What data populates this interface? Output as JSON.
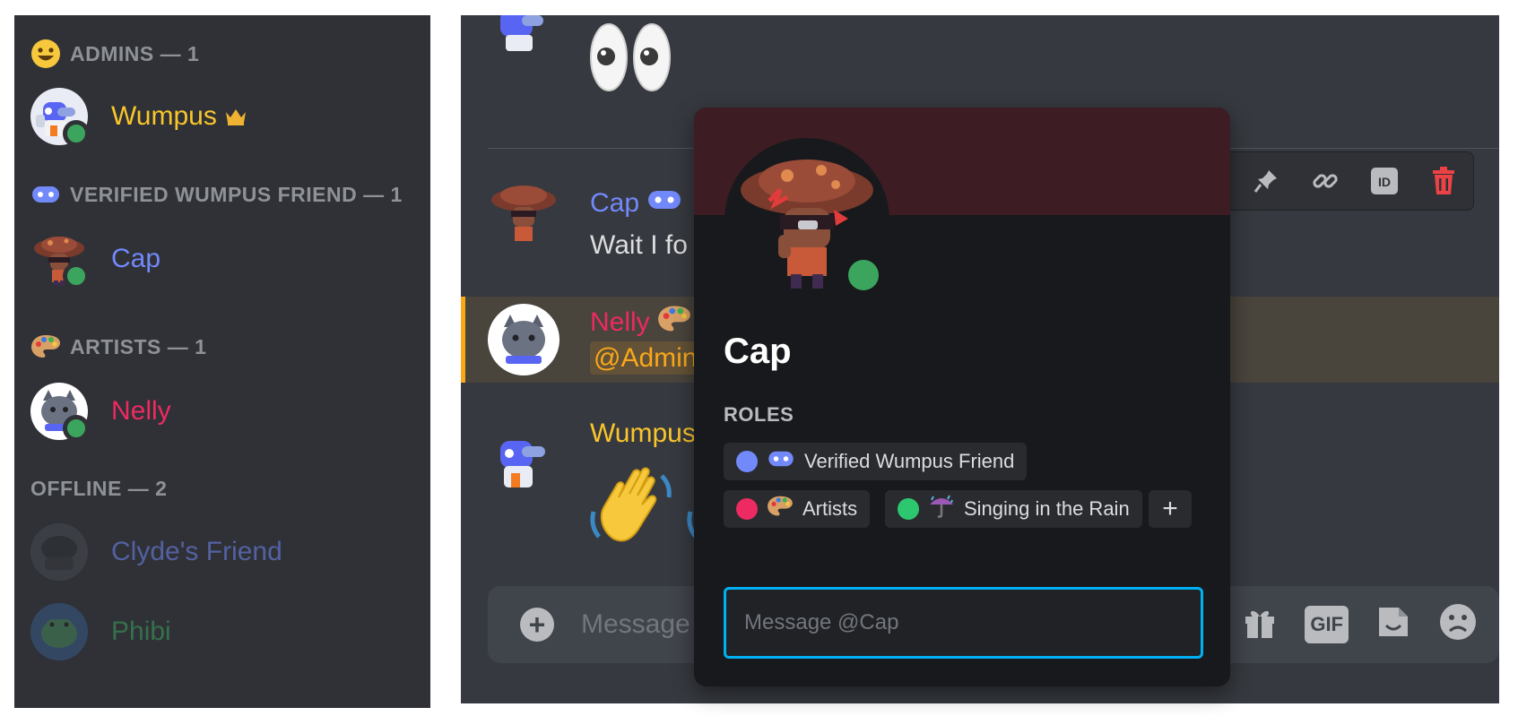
{
  "member_list": {
    "groups": [
      {
        "header": "ADMINS — 1",
        "icon": "smiley-emoji-icon",
        "members": [
          {
            "name": "Wumpus",
            "color": "#f9c62b",
            "badge": "crown-icon",
            "status": "online"
          }
        ]
      },
      {
        "header": "VERIFIED WUMPUS FRIEND — 1",
        "icon": "wumpus-face-icon",
        "members": [
          {
            "name": "Cap",
            "color": "#7289fa",
            "status": "online"
          }
        ]
      },
      {
        "header": "ARTISTS — 1",
        "icon": "palette-emoji-icon",
        "members": [
          {
            "name": "Nelly",
            "color": "#ed2a62",
            "status": "online"
          }
        ]
      },
      {
        "header": "OFFLINE — 2",
        "members": [
          {
            "name": "Clyde's Friend",
            "color": "#7289fa",
            "status": "offline"
          },
          {
            "name": "Phibi",
            "color": "#3ba55d",
            "status": "offline"
          }
        ]
      }
    ]
  },
  "chat": {
    "messages": [
      {
        "author": "",
        "content": "eyes-emoji"
      },
      {
        "author": "Cap",
        "author_color": "#7289fa",
        "content": "Wait I fo"
      },
      {
        "author": "Nelly",
        "author_color": "#ed2a62",
        "mention": "@Admin"
      },
      {
        "author": "Wumpus",
        "author_color": "#f9c62b",
        "content": "waving-hands-emoji"
      }
    ],
    "composer_placeholder": "Message",
    "toolbar_icons": [
      "pin-icon",
      "link-icon",
      "id-icon",
      "delete-icon"
    ],
    "composer_icons": [
      "gift-icon",
      "gif-icon",
      "sticker-icon",
      "emoji-icon"
    ],
    "gif_label": "GIF"
  },
  "profile_popout": {
    "name": "Cap",
    "banner_color": "#3e1c24",
    "roles_title": "ROLES",
    "roles": [
      {
        "name": "Verified Wumpus Friend",
        "color": "#7289fa",
        "icon": "wumpus-face-icon"
      },
      {
        "name": "Artists",
        "color": "#ed2a62",
        "icon": "palette-emoji-icon"
      },
      {
        "name": "Singing in the Rain",
        "color": "#2dc770",
        "icon": "umbrella-emoji-icon"
      }
    ],
    "add_role_label": "+",
    "message_placeholder": "Message @Cap"
  },
  "colors": {
    "online": "#3ba55d",
    "accent_focus": "#00b0f4",
    "mention_highlight": "#faa81a"
  }
}
